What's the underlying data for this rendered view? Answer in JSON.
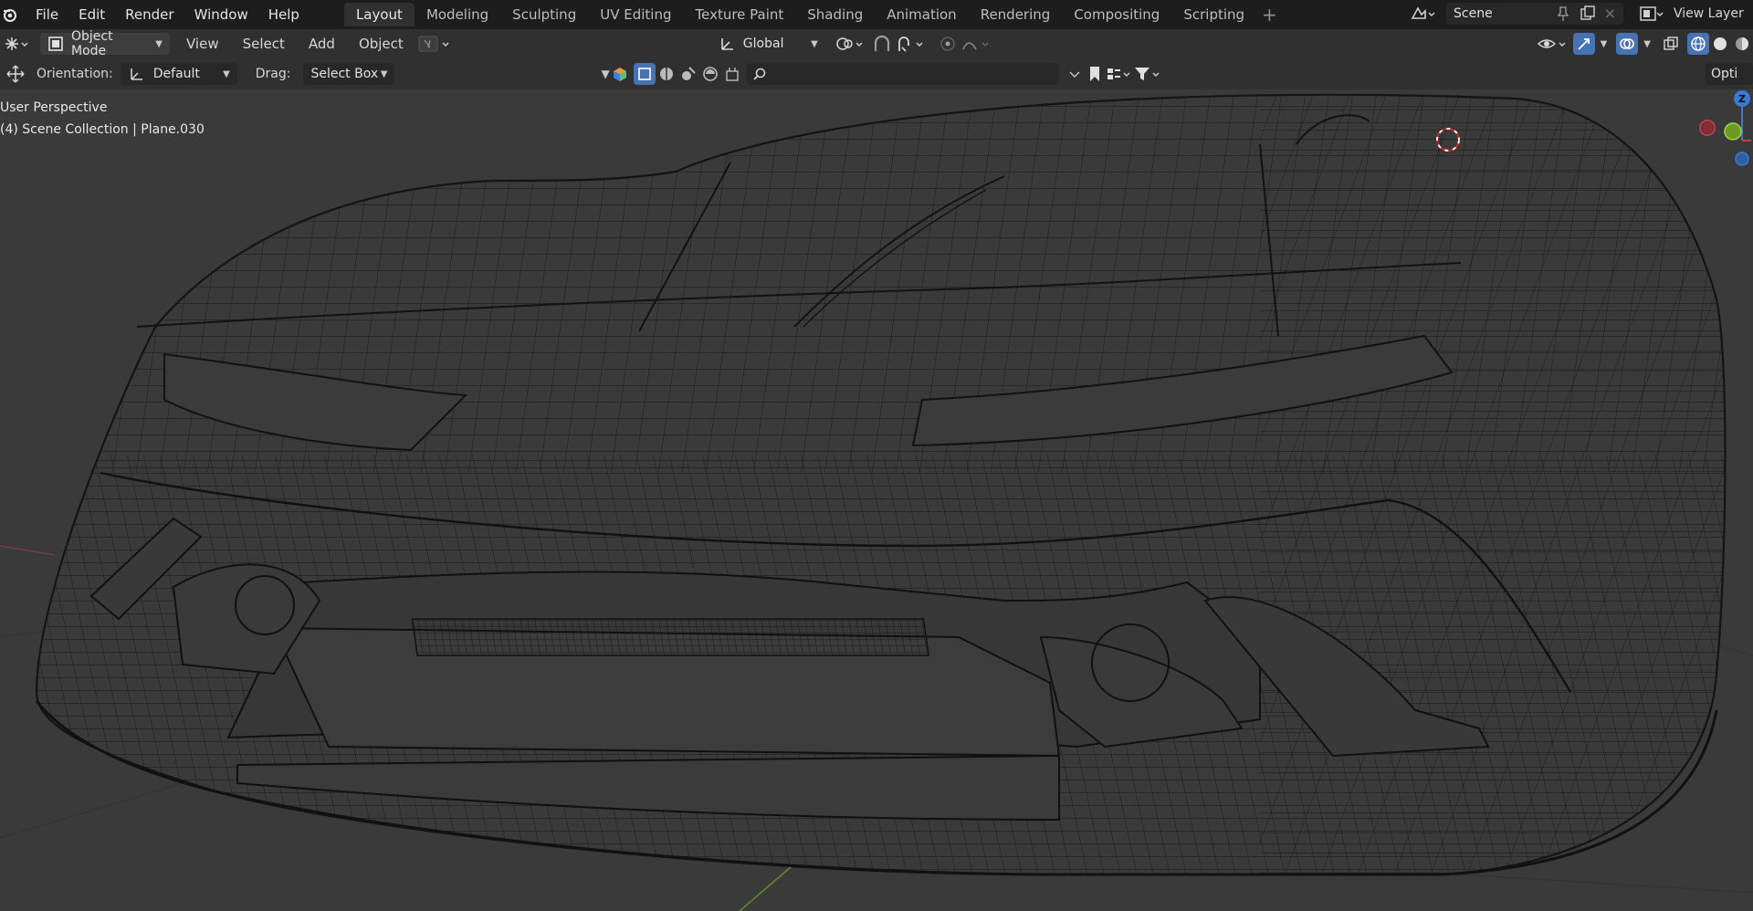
{
  "menu": {
    "items": [
      "File",
      "Edit",
      "Render",
      "Window",
      "Help"
    ]
  },
  "workspaces": {
    "tabs": [
      "Layout",
      "Modeling",
      "Sculpting",
      "UV Editing",
      "Texture Paint",
      "Shading",
      "Animation",
      "Rendering",
      "Compositing",
      "Scripting"
    ],
    "active": "Layout"
  },
  "scene": {
    "label": "Scene"
  },
  "view_layer": {
    "label": "View Layer"
  },
  "header": {
    "mode": "Object Mode",
    "view": "View",
    "select": "Select",
    "add": "Add",
    "object": "Object",
    "transform_orientation": "Global"
  },
  "tool_settings": {
    "orientation_label": "Orientation:",
    "orientation_value": "Default",
    "drag_label": "Drag:",
    "drag_value": "Select Box",
    "options_label": "Opti"
  },
  "viewport": {
    "perspective": "User Perspective",
    "collection": "(4) Scene Collection | Plane.030",
    "shading": "wireframe",
    "axes": {
      "x": "X",
      "y": "Y",
      "z": "Z"
    }
  },
  "colors": {
    "background": "#393939",
    "topbar": "#1d1d1d",
    "header": "#303030",
    "accent": "#4772b3",
    "wire": "#141414",
    "axis_x": "#c23b4a",
    "axis_y": "#6c9a23",
    "axis_z": "#3b7ad1"
  }
}
